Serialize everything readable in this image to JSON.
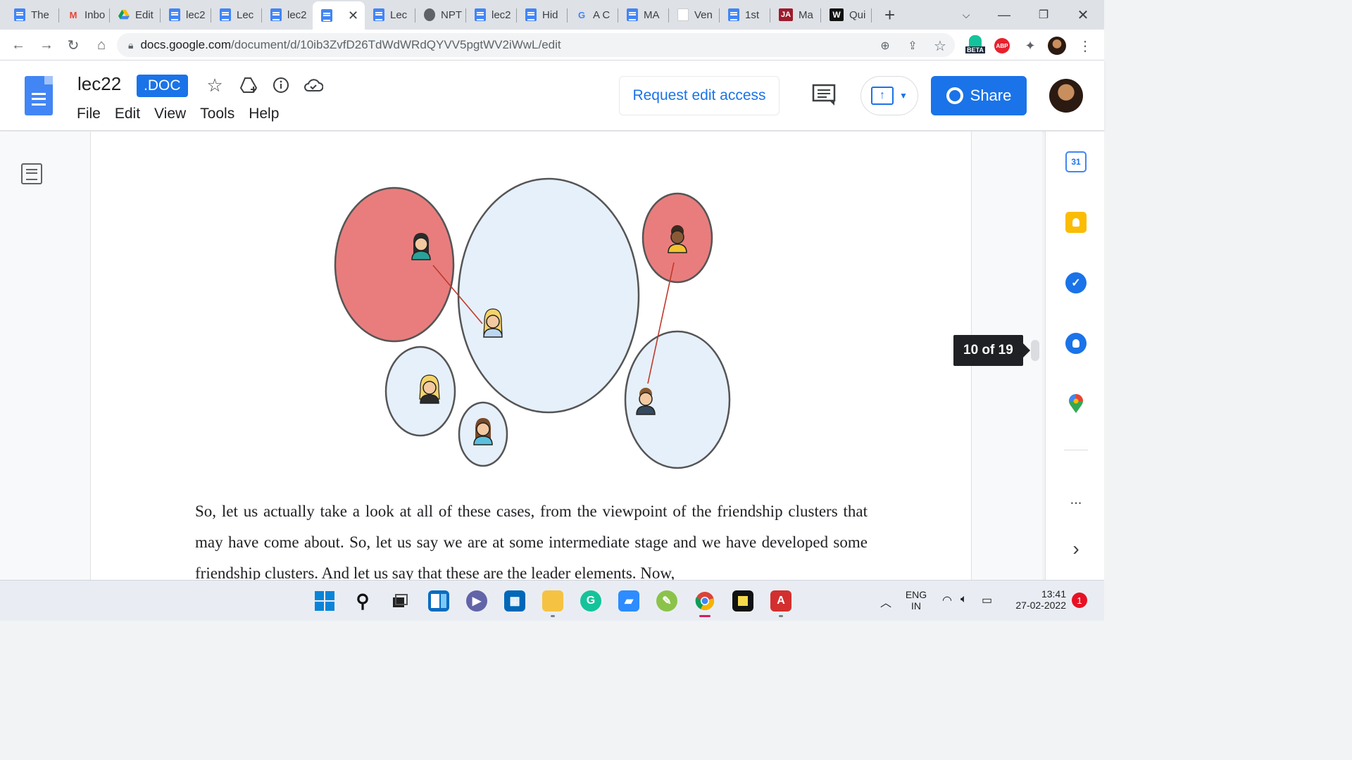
{
  "browser": {
    "tabs": [
      {
        "title": "The",
        "icon": "docs-icon"
      },
      {
        "title": "Inbo",
        "icon": "gmail-icon"
      },
      {
        "title": "Edit",
        "icon": "drive-icon"
      },
      {
        "title": "lec2",
        "icon": "docs-icon"
      },
      {
        "title": "Lec",
        "icon": "docs-icon"
      },
      {
        "title": "lec2",
        "icon": "docs-icon"
      },
      {
        "title": "",
        "icon": "docs-icon",
        "active": true
      },
      {
        "title": "Lec",
        "icon": "docs-icon"
      },
      {
        "title": "NPT",
        "icon": "globe-icon"
      },
      {
        "title": "lec2",
        "icon": "docs-icon"
      },
      {
        "title": "Hid",
        "icon": "docs-icon"
      },
      {
        "title": "A C",
        "icon": "google-icon"
      },
      {
        "title": "MA",
        "icon": "docs-icon"
      },
      {
        "title": "Ven",
        "icon": "blank-icon"
      },
      {
        "title": "1st",
        "icon": "docs-icon"
      },
      {
        "title": "Ma",
        "icon": "ja-icon"
      },
      {
        "title": "Qui",
        "icon": "w-icon"
      }
    ],
    "ja_icon_text": "JA",
    "w_icon_text": "W",
    "new_tab_label": "+",
    "url": {
      "host": "docs.google.com",
      "path": "/document/d/10ib3ZvfD26TdWdWRdQYVV5pgtWV2iWwL/edit"
    },
    "ext_beta_label": "BETA",
    "ext_abp_label": "ABP"
  },
  "doc": {
    "title": "lec22",
    "badge": ".DOC",
    "menu": [
      "File",
      "Edit",
      "View",
      "Tools",
      "Help"
    ],
    "request_edit_label": "Request edit access",
    "share_label": "Share",
    "page_counter": "10 of 19",
    "paragraph": "So, let us actually take a look at all of these cases, from the viewpoint of the friendship clusters that may have come about. So, let us say we are at some intermediate stage and we have developed some friendship clusters. And let us say that these are the leader elements. Now,"
  },
  "side_panel": {
    "calendar_day": "31",
    "items": [
      "calendar-icon",
      "keep-icon",
      "tasks-icon",
      "contacts-icon",
      "maps-icon"
    ],
    "more_label": "...",
    "expand_label": "›"
  },
  "taskbar": {
    "lang": "ENG",
    "region": "IN",
    "time": "13:41",
    "date": "27-02-2022",
    "notification_count": "1"
  },
  "colors": {
    "accent": "#1a73e8",
    "cluster_red": "#e97d7d",
    "cluster_blue": "#e6f0fa",
    "link_line": "#c0392b"
  }
}
